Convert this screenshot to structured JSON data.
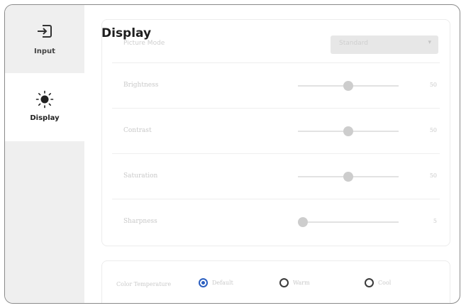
{
  "sidebar": {
    "items": [
      {
        "label": "Input",
        "icon": "input-icon"
      },
      {
        "label": "Display",
        "icon": "brightness-icon",
        "selected": true
      }
    ]
  },
  "main": {
    "title": "Display",
    "partial_row": {
      "label": "Picture Mode",
      "dropdown_value": "Standard"
    },
    "sliders": [
      {
        "label": "Brightness",
        "value": "50"
      },
      {
        "label": "Contrast",
        "value": "50"
      },
      {
        "label": "Saturation",
        "value": "50"
      },
      {
        "label": "Sharpness",
        "value": "5"
      }
    ],
    "slider_levels": [
      0.5,
      0.5,
      0.5,
      0.05
    ],
    "color_temperature": {
      "label": "Color Temperature",
      "options": [
        "Default",
        "Warm",
        "Cool"
      ],
      "selected": "Default"
    }
  },
  "colors": {
    "accent": "#2b5fc0",
    "sidebar_bg": "#efefef"
  }
}
